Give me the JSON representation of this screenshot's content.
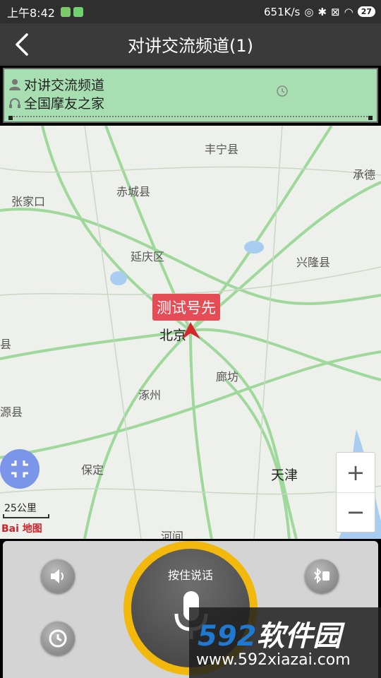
{
  "status_bar": {
    "time": "上午8:42",
    "net_speed": "651K/s",
    "battery": "27"
  },
  "header": {
    "title": "对讲交流频道(1)"
  },
  "channel_info": {
    "channel_name": "对讲交流频道",
    "group_name": "全国摩友之家"
  },
  "map": {
    "labels": {
      "fengning": "丰宁县",
      "chengde": "承德",
      "zhangjiakou": "张家口",
      "chicheng": "赤城县",
      "yanqing": "延庆区",
      "xinglong": "兴隆县",
      "beijing": "北京",
      "langfang": "廊坊",
      "zhuozhou": "涿州",
      "yuanxian": "源县",
      "baoding": "保定",
      "tianjin": "天津",
      "hejian": "河间",
      "county_left": "县"
    },
    "marker_label": "测试号先",
    "scale_label": "25公里",
    "logo": "Bai 地图",
    "zoom_in": "+",
    "zoom_out": "−"
  },
  "controls": {
    "ptt_label": "按住说话"
  },
  "watermark": {
    "brand_number": "592",
    "brand_text": "软件园",
    "url": "www.592xiazai.com"
  },
  "colors": {
    "accent_ring": "#f2b80b",
    "channel_bg": "#a8dfb2",
    "marker": "#e54c55"
  },
  "icons": [
    "back-icon",
    "user-icon",
    "headphone-icon",
    "history-icon",
    "speaker-icon",
    "bluetooth-icon",
    "mic-icon",
    "locate-icon"
  ]
}
